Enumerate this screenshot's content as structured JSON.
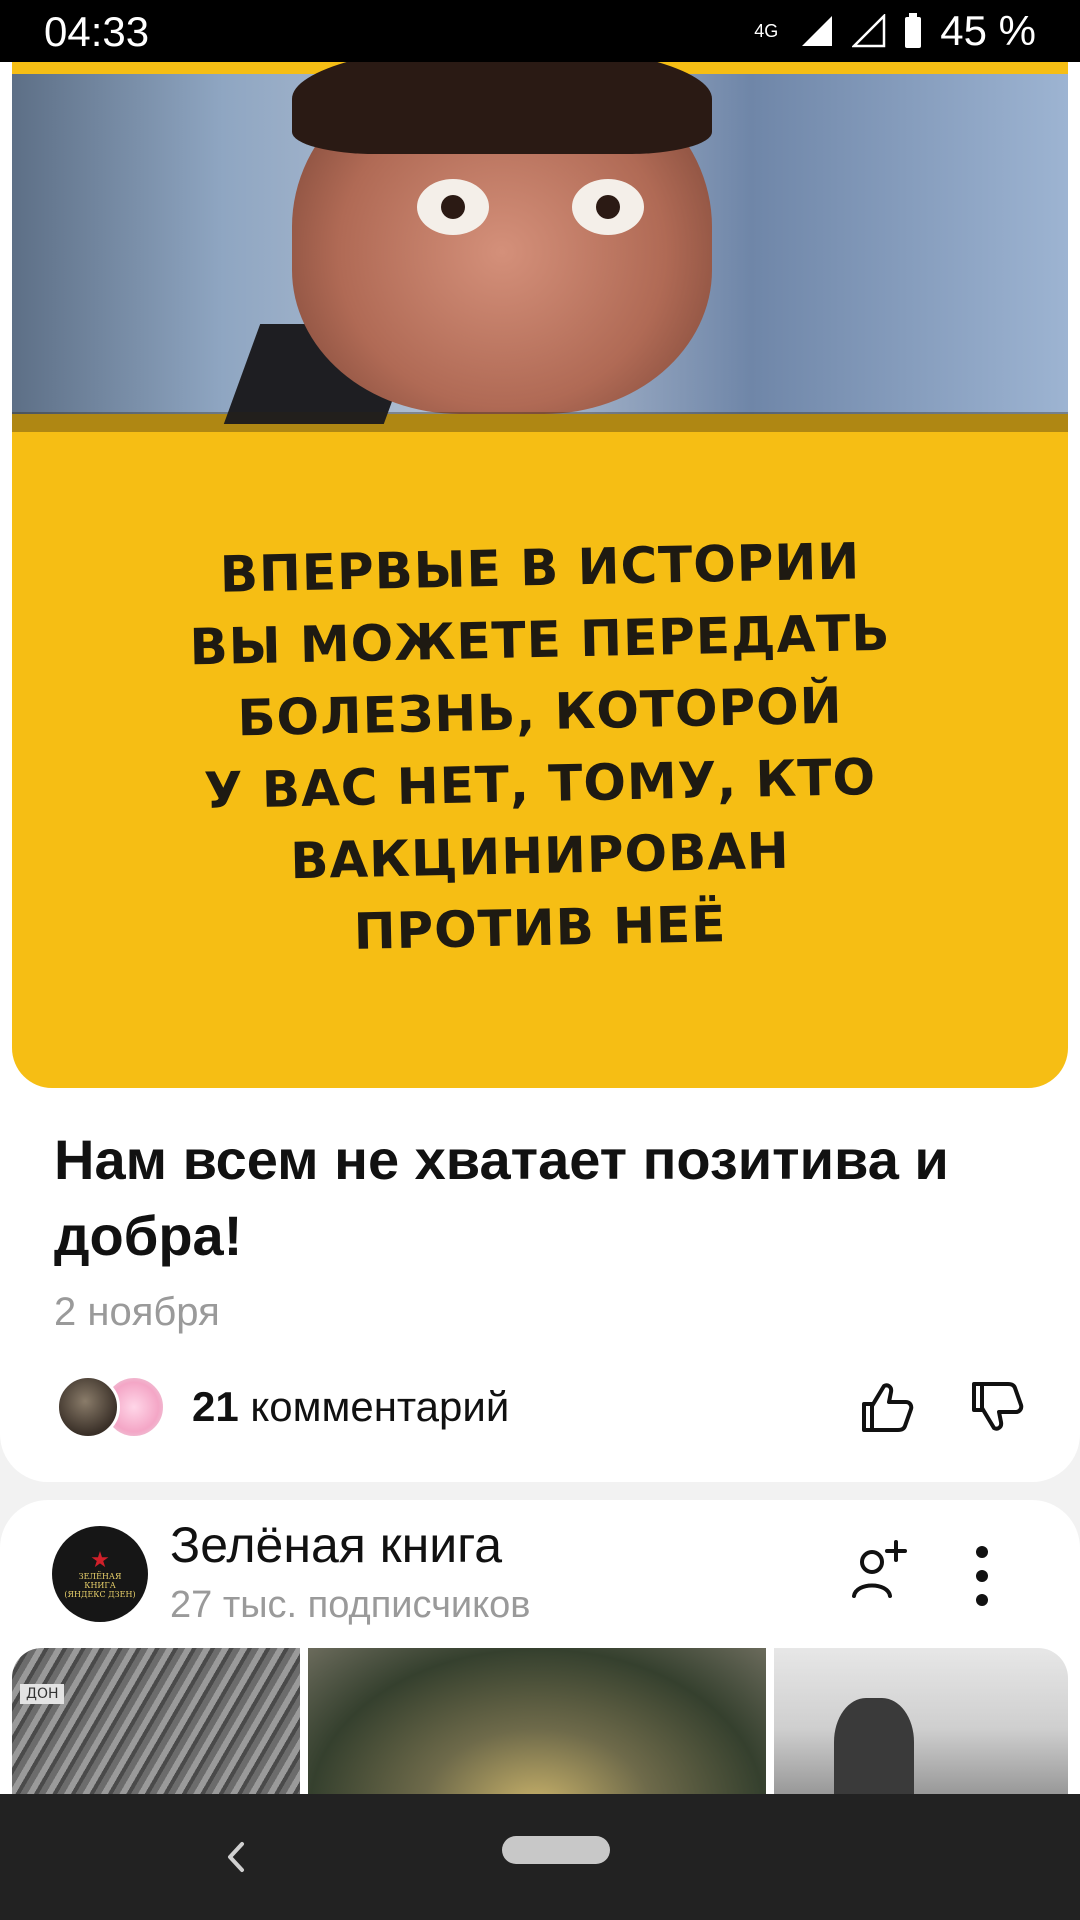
{
  "status_bar": {
    "time": "04:33",
    "network": "4G",
    "battery": "45 %"
  },
  "post": {
    "image_text_lines": [
      "ВПЕРВЫЕ В ИСТОРИИ",
      "ВЫ МОЖЕТЕ ПЕРЕДАТЬ",
      "БОЛЕЗНЬ, КОТОРОЙ",
      "У ВАС НЕТ, ТОМУ, КТО",
      "ВАКЦИНИРОВАН",
      "ПРОТИВ НЕЁ"
    ],
    "title": "Нам всем не хватает позитива и добра!",
    "date": "2 ноября",
    "comments_count": "21",
    "comments_label": "комментарий",
    "like_icon": "thumbs-up-icon",
    "dislike_icon": "thumbs-down-icon"
  },
  "channel": {
    "name": "Зелёная книга",
    "subscribers": "27 тыс. подписчиков",
    "avatar_text": [
      "ЗЕЛЁНАЯ",
      "КНИГА",
      "(ЯНДЕКС ДЗЕН)"
    ],
    "thumbnail_label": "ДОН"
  },
  "colors": {
    "meme_yellow": "#f6be14",
    "nav_bar": "#222222",
    "status_bar": "#000000"
  }
}
